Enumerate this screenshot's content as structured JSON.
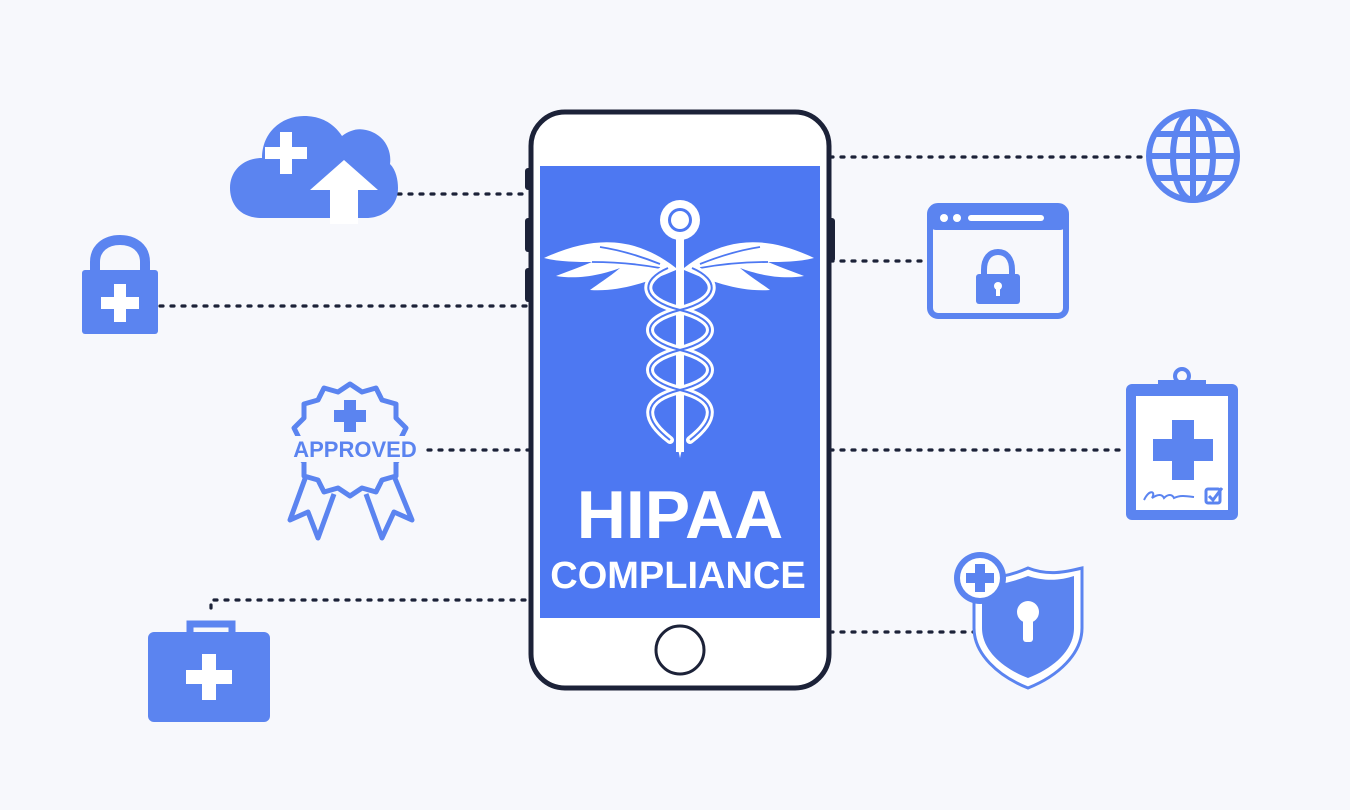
{
  "phone": {
    "title": "HIPAA",
    "subtitle": "COMPLIANCE"
  },
  "badge": {
    "label": "APPROVED"
  },
  "colors": {
    "background": "#f7f8fc",
    "accent": "#5b84f0",
    "screen": "#4d78f2",
    "outline": "#1c2238",
    "white": "#ffffff"
  },
  "icons": [
    "cloud-upload-medical-icon",
    "padlock-medical-icon",
    "approved-badge-icon",
    "first-aid-kit-icon",
    "globe-icon",
    "secure-browser-icon",
    "medical-clipboard-icon",
    "medical-shield-keyhole-icon",
    "caduceus-icon"
  ]
}
